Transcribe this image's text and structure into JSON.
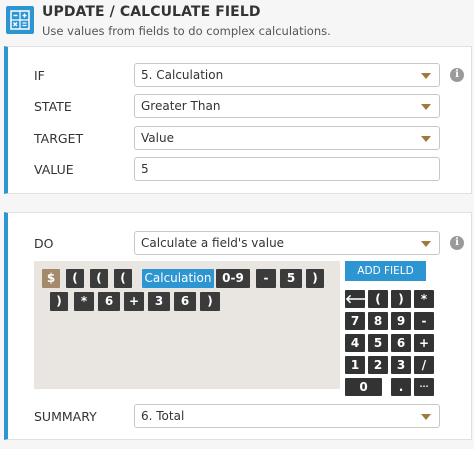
{
  "header": {
    "title": "UPDATE / CALCULATE FIELD",
    "subtitle": "Use values from fields to do complex calculations.",
    "icon": "calculator-icon"
  },
  "condition": {
    "if_label": "IF",
    "if_value": "5. Calculation",
    "state_label": "STATE",
    "state_value": "Greater Than",
    "target_label": "TARGET",
    "target_value": "Value",
    "value_label": "VALUE",
    "value_value": "5",
    "info_glyph": "i"
  },
  "action": {
    "do_label": "DO",
    "do_value": "Calculate a field's value",
    "add_field_label": "ADD FIELD",
    "summary_label": "SUMMARY",
    "summary_value": "6. Total"
  },
  "formula": {
    "tokens": [
      "$",
      "(",
      "(",
      "(",
      "Calculation",
      "0-9",
      "-",
      "5",
      ")",
      ")",
      "*",
      "6",
      "+",
      "3",
      "6",
      ")"
    ]
  },
  "keypad": {
    "keys": [
      "🡐",
      "(",
      ")",
      "*",
      "7",
      "8",
      "9",
      "-",
      "4",
      "5",
      "6",
      "+",
      "1",
      "2",
      "3",
      "/",
      "0",
      ".",
      "···"
    ]
  },
  "colors": {
    "accent": "#2e95d3",
    "token_dark": "#3b3b3b",
    "token_dollar": "#a4896a",
    "formula_bg": "#e9e5e0"
  }
}
